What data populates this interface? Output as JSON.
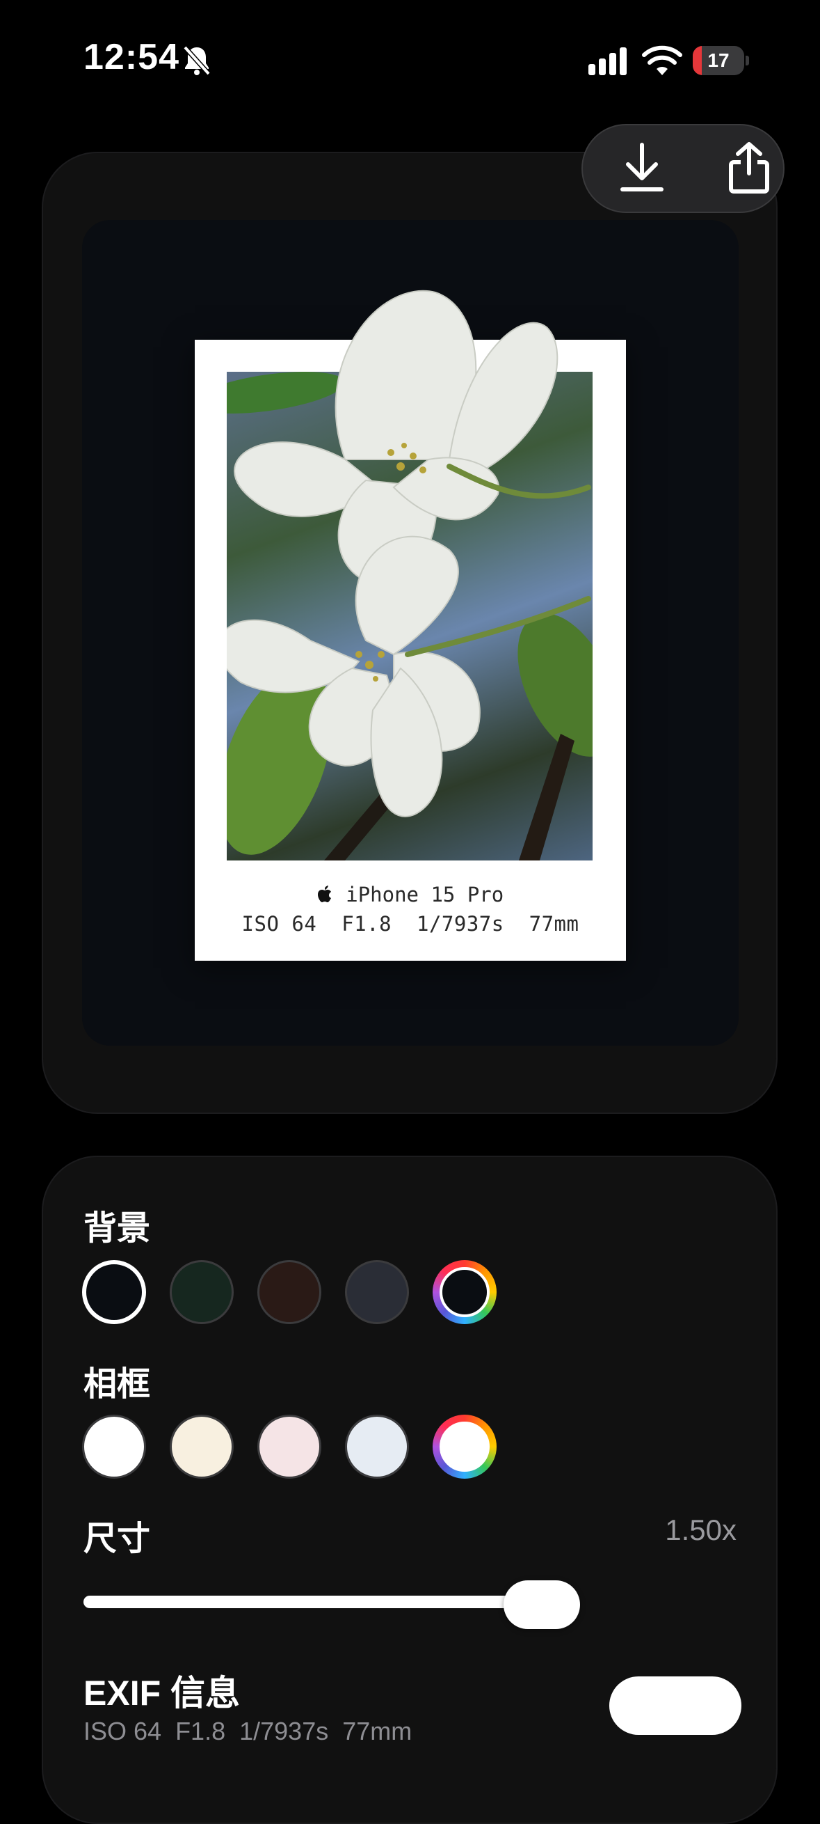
{
  "status_bar": {
    "time": "12:54",
    "battery_level": "17",
    "battery_fraction": 0.17,
    "battery_color": "#e5373a",
    "silent_icon": "bell-slash-icon",
    "signal_icon": "cellular-signal-icon",
    "wifi_icon": "wifi-icon"
  },
  "actions": {
    "download_icon": "download-icon",
    "share_icon": "share-icon"
  },
  "preview": {
    "camera_logo": "apple-logo-icon",
    "model": "iPhone 15 Pro",
    "exif_line": "ISO 64  F1.8  1/7937s  77mm"
  },
  "controls": {
    "background": {
      "label": "背景",
      "swatches": [
        "#0a0d12",
        "#16271f",
        "#2a1a16",
        "#2a2d36"
      ],
      "selected_index": 0,
      "custom_inner": "#0a0d12"
    },
    "frame": {
      "label": "相框",
      "swatches": [
        "#ffffff",
        "#f8f0e0",
        "#f5e4e6",
        "#e6ecf3"
      ],
      "selected_index": -1,
      "custom_inner": "#ffffff"
    },
    "size": {
      "label": "尺寸",
      "value": "1.50x",
      "slider_fraction": 1.0
    },
    "exif": {
      "title": "EXIF 信息",
      "detail": "ISO 64  F1.8  1/7937s  77mm",
      "enabled": true
    }
  }
}
